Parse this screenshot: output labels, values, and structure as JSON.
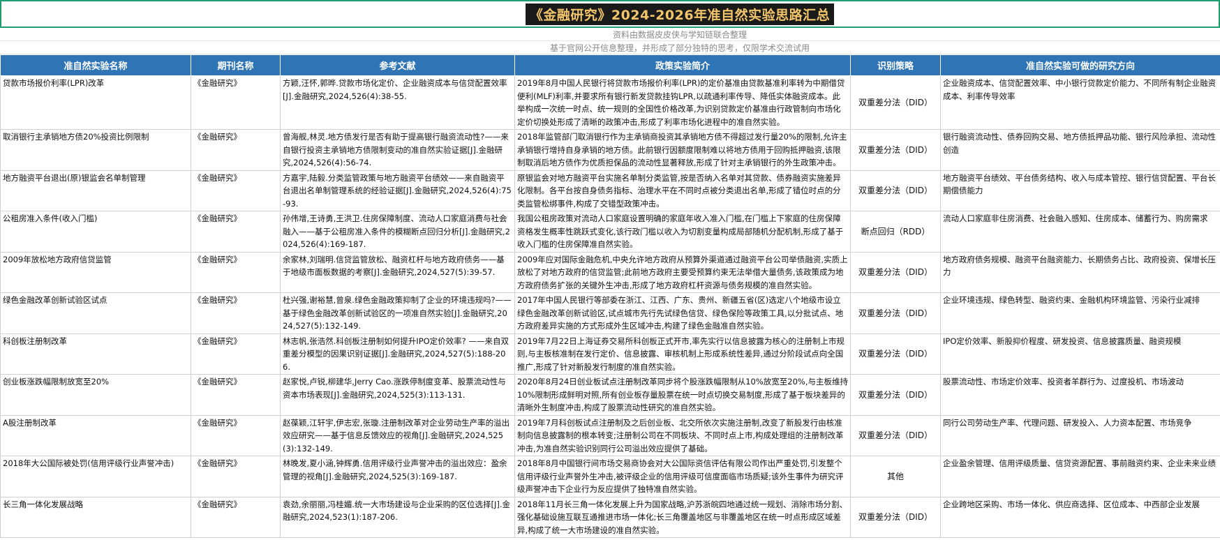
{
  "title": "《金融研究》2024-2026年准自然实验思路汇总",
  "subtitles": [
    "资料由数据皮皮侠与学知链联合整理",
    "基于官网公开信息整理，并形成了部分独特的思考，仅限学术交流试用"
  ],
  "columns": [
    "准自然实验名称",
    "期刊名称",
    "参考文献",
    "政策实验简介",
    "识别策略",
    "准自然实验可做的研究方向"
  ],
  "rows": [
    {
      "name": "贷款市场报价利率(LPR)改革",
      "journal": "《金融研究》",
      "ref": "方颖,汪怀,郭晔.贷款市场化定价、企业融资成本与信贷配置效率[J].金融研究,2024,526(4):38-55.",
      "intro": "2019年8月中国人民银行将贷款市场报价利率(LPR)的定价基准由贷款基准利率转为中期借贷便利(MLF)利率,并要求所有银行新发贷款挂钩LPR,以疏通利率传导、降低实体融资成本。此举构成一次统一时点、统一规则的全国性价格改革,为识别贷款定价基准由行政管制向市场化定价切换处形成了清晰的政策冲击,形成了利率市场化进程中的准自然实验。",
      "strategy": "双重差分法（DID）",
      "direction": "企业融资成本、信贷配置效率、中小银行贷款定价能力、不同所有制企业融资成本、利率传导效率"
    },
    {
      "name": "取消银行主承销地方债20%投资比例限制",
      "journal": "《金融研究》",
      "ref": "曾海舰,林灵.地方债发行是否有助于提高银行融资流动性?——来自银行投资主承销地方债限制变动的准自然实验证据[J].金融研究,2024,526(4):56-74.",
      "intro": "2018年监管部门取消银行作为主承销商投资其承销地方债不得超过发行量20%的限制,允许主承销银行增持自身承销的地方债。此前银行因额度限制难以将地方债用于回购抵押融资,该限制取消后地方债作为优质担保品的流动性显著释放,形成了针对主承销银行的外生政策冲击。",
      "strategy": "双重差分法（DID）",
      "direction": "银行融资流动性、债券回购交易、地方债抵押品功能、银行风险承担、流动性创造"
    },
    {
      "name": "地方融资平台退出(原)银监会名单制管理",
      "journal": "《金融研究》",
      "ref": "方嘉宇,陆毅.分类监管政策与地方融资平台绩效——来自融资平台退出名单制管理系统的经验证据[J].金融研究,2024,526(4):75-93.",
      "intro": "原银监会对地方融资平台实施名单制分类监管,按是否纳入名单对其贷款、债券融资实施差异化限制。各平台按自身债务指标、治理水平在不同时点被分类退出名单,形成了错位时点的分类监管松绑事件,构成了交错型政策冲击。",
      "strategy": "双重差分法（DID）",
      "direction": "地方融资平台绩效、平台债务结构、收入与成本管控、银行信贷配置、平台长期偿债能力"
    },
    {
      "name": "公租房准入条件(收入门槛)",
      "journal": "《金融研究》",
      "ref": "孙伟增,王诗勇,王洪卫.住房保障制度、流动人口家庭消费与社会融入——基于公租房准入条件的模糊断点回归分析[J].金融研究,2024,526(4):169-187.",
      "intro": "我国公租房政策对流动人口家庭设置明确的家庭年收入准入门槛,在门槛上下家庭的住房保障资格发生概率性跳跃式变化,该行政门槛以收入为切割变量构成局部随机分配机制,形成了基于收入门槛的住房保障准自然实验。",
      "strategy": "断点回归（RDD）",
      "direction": "流动人口家庭非住房消费、社会融入感知、住房成本、储蓄行为、购房需求"
    },
    {
      "name": "2009年放松地方政府信贷监管",
      "journal": "《金融研究》",
      "ref": "余家林,刘瑞明.信贷监管放松、融资杠杆与地方政府债务——基于地级市面板数据的考察[J].金融研究,2024,527(5):39-57.",
      "intro": "2009年应对国际金融危机,中央允许地方政府从预算外渠道通过融资平台公司举债融资,实质上放松了对地方政府的信贷监管;此前地方政府主要受预算约束无法举借大量债务,该政策成为地方政府债务扩张的关键外生冲击,形成了地方政府杠杆资源与债务规模的准自然实验。",
      "strategy": "双重差分法（DID）",
      "direction": "地方政府债务规模、融资平台融资能力、长期债务占比、政府投资、保增长压力"
    },
    {
      "name": "绿色金融改革创新试验区试点",
      "journal": "《金融研究》",
      "ref": "杜兴强,谢裕慧,曾泉.绿色金融政策抑制了企业的环境违规吗?——基于绿色金融改革创新试验区的一项准自然实验[J].金融研究,2024,527(5):132-149.",
      "intro": "2017年中国人民银行等部委在浙江、江西、广东、贵州、新疆五省(区)选定八个地级市设立绿色金融改革创新试验区,试点城市先行先试绿色信贷、绿色保险等政策工具,以分批试点、地方政府差异实施的方式形成外生区域冲击,构建了绿色金融准自然实验。",
      "strategy": "双重差分法（DID）",
      "direction": "企业环境违规、绿色转型、融资约束、金融机构环境监管、污染行业减排"
    },
    {
      "name": "科创板注册制改革",
      "journal": "《金融研究》",
      "ref": "林志帆,张浩然.科创板注册制如何提升IPO定价效率? ——来自双重差分模型的因果识别证据[J].金融研究,2024,527(5):188-206.",
      "intro": "2019年7月22日上海证券交易所科创板正式开市,率先实行以信息披露为核心的注册制上市规则,与主板核准制在发行定价、信息披露、审核机制上形成系统性差异,通过分阶段试点向全国推广,形成了针对新股发行制度的准自然实验。",
      "strategy": "双重差分法（DID）",
      "direction": "IPO定价效率、新股抑价程度、研发投资、信息披露质量、融资规模"
    },
    {
      "name": "创业板涨跌幅限制放宽至20%",
      "journal": "《金融研究》",
      "ref": "赵家悦,卢锐,柳建华,Jerry Cao.涨跌停制度变革、股票流动性与资本市场表现[J].金融研究,2024,525(3):113-131.",
      "intro": "2020年8月24日创业板试点注册制改革同步将个股涨跌幅限制从10%放宽至20%,与主板维持10%限制形成鲜明对照,所有创业板存量股票在统一时点切换交易制度,形成了基于板块差异的清晰外生制度冲击,构成了股票流动性研究的准自然实验。",
      "strategy": "双重差分法（DID）",
      "direction": "股票流动性、市场定价效率、投资者羊群行为、过度投机、市场波动"
    },
    {
      "name": "A股注册制改革",
      "journal": "《金融研究》",
      "ref": "赵葆颖,江轩宇,伊志宏,张璇.注册制改革对企业劳动生产率的溢出效应研究——基于信息反馈效应的视角[J].金融研究,2024,525(3):132-149.",
      "intro": "2019年7月科创板试点注册制及之后创业板、北交所依次实施注册制,改变了新股发行由核准制向信息披露制的根本转变;注册制公司在不同板块、不同时点上市,构成处理组的注册制改革冲击,为准自然实验识别同行公司溢出效应提供了基础。",
      "strategy": "双重差分法（DID）",
      "direction": "同行公司劳动生产率、代理问题、研发投入、人力资本配置、市场竞争"
    },
    {
      "name": "2018年大公国际被处罚(信用评级行业声誉冲击)",
      "journal": "《金融研究》",
      "ref": "林晚发,夏小涵,钟辉勇.信用评级行业声誉冲击的溢出效应：盈余管理的视角[J].金融研究,2024,525(3):169-187.",
      "intro": "2018年8月中国银行间市场交易商协会对大公国际资信评估有限公司作出严重处罚,引发整个信用评级行业声誉外生冲击,被评级企业的信用评级可信度面临市场质疑;该外生事件为研究评级声誉冲击下企业行为反应提供了独特准自然实验。",
      "strategy": "其他",
      "direction": "企业盈余管理、信用评级质量、信贷资源配置、事前融资约束、企业未来业绩"
    },
    {
      "name": "长三角一体化发展战略",
      "journal": "《金融研究》",
      "ref": "袁劲,余丽丽,冯桂媚.统一大市场建设与企业采购的区位选择[J].金融研究,2024,523(1):187-206.",
      "intro": "2018年11月长三角一体化发展上升为国家战略,沪苏浙皖四地通过统一规划、消除市场分割、强化基础设施互联互通推进市场一体化;长三角覆盖地区与非覆盖地区在统一时点形成区域差异,构成了统一大市场建设的准自然实验。",
      "strategy": "双重差分法（DID）",
      "direction": "企业跨地区采购、市场一体化、供应商选择、区位成本、中西部企业发展"
    }
  ]
}
